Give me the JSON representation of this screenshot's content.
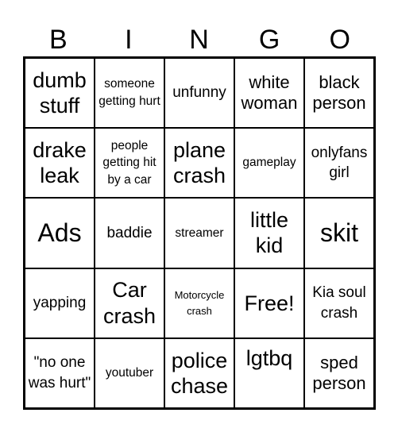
{
  "header": {
    "letters": [
      "B",
      "I",
      "N",
      "G",
      "O"
    ]
  },
  "cells": [
    "dumb stuff",
    "someone getting hurt",
    "unfunny",
    "white woman",
    "black person",
    "drake leak",
    "people getting hit by a car",
    "plane crash",
    "gameplay",
    "onlyfans girl",
    "Ads",
    "baddie",
    "streamer",
    "little kid",
    "skit",
    "yapping",
    "Car crash",
    "Motorcycle crash",
    "Free!",
    "Kia soul crash",
    "\"no one was hurt\"",
    "youtuber",
    "police chase",
    "lgtbq",
    "sped person"
  ]
}
